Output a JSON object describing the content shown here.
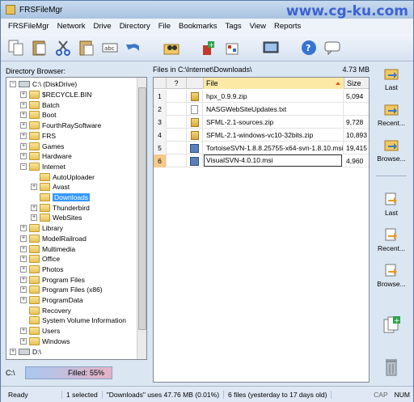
{
  "window": {
    "title": "FRSFileMgr",
    "watermark": "www.cg-ku.com"
  },
  "menu": [
    "FRSFileMgr",
    "Network",
    "Drive",
    "Directory",
    "File",
    "Bookmarks",
    "Tags",
    "View",
    "Reports"
  ],
  "left": {
    "label": "Directory Browser:",
    "tree": [
      {
        "label": "C:\\ (DiskDrive)",
        "level": 0,
        "type": "drive",
        "exp": "-"
      },
      {
        "label": "$RECYCLE.BIN",
        "level": 1,
        "exp": "+"
      },
      {
        "label": "Batch",
        "level": 1,
        "exp": "+"
      },
      {
        "label": "Boot",
        "level": 1,
        "exp": "+"
      },
      {
        "label": "FourthRaySoftware",
        "level": 1,
        "exp": "+"
      },
      {
        "label": "FRS",
        "level": 1,
        "exp": "+"
      },
      {
        "label": "Games",
        "level": 1,
        "exp": "+"
      },
      {
        "label": "Hardware",
        "level": 1,
        "exp": "+"
      },
      {
        "label": "Internet",
        "level": 1,
        "exp": "-"
      },
      {
        "label": "AutoUploader",
        "level": 2,
        "exp": ""
      },
      {
        "label": "Avast",
        "level": 2,
        "exp": "+"
      },
      {
        "label": "Downloads",
        "level": 2,
        "exp": "",
        "selected": true
      },
      {
        "label": "Thunderbird",
        "level": 2,
        "exp": "+"
      },
      {
        "label": "WebSites",
        "level": 2,
        "exp": "+"
      },
      {
        "label": "Library",
        "level": 1,
        "exp": "+"
      },
      {
        "label": "ModelRailroad",
        "level": 1,
        "exp": "+"
      },
      {
        "label": "Multimedia",
        "level": 1,
        "exp": "+"
      },
      {
        "label": "Office",
        "level": 1,
        "exp": "+"
      },
      {
        "label": "Photos",
        "level": 1,
        "exp": "+"
      },
      {
        "label": "Program Files",
        "level": 1,
        "exp": "+"
      },
      {
        "label": "Program Files (x86)",
        "level": 1,
        "exp": "+"
      },
      {
        "label": "ProgramData",
        "level": 1,
        "exp": "+"
      },
      {
        "label": "Recovery",
        "level": 1,
        "exp": ""
      },
      {
        "label": "System Volume Information",
        "level": 1,
        "exp": ""
      },
      {
        "label": "Users",
        "level": 1,
        "exp": "+"
      },
      {
        "label": "Windows",
        "level": 1,
        "exp": "+"
      },
      {
        "label": "D:\\",
        "level": 0,
        "type": "drive",
        "exp": "+"
      }
    ],
    "drive": "C:\\",
    "filled_label": "Filled:",
    "filled_pct": "55%"
  },
  "center": {
    "path_label": "Files in C:\\Internet\\Downloads\\",
    "size_total": "4.73 MB",
    "columns": {
      "q": "?",
      "file": "File",
      "size": "Size"
    },
    "files": [
      {
        "num": "1",
        "name": "hpx_0.9.9.zip",
        "size": "5,094",
        "kind": "zip"
      },
      {
        "num": "2",
        "name": "NASGWebSiteUpdates.txt",
        "size": "",
        "kind": "txt"
      },
      {
        "num": "3",
        "name": "SFML-2.1-sources.zip",
        "size": "9,728",
        "kind": "zip"
      },
      {
        "num": "4",
        "name": "SFML-2.1-windows-vc10-32bits.zip",
        "size": "10,893",
        "kind": "zip"
      },
      {
        "num": "5",
        "name": "TortoiseSVN-1.8.8.25755-x64-svn-1.8.10.msi",
        "size": "19,415",
        "kind": "msi"
      },
      {
        "num": "6",
        "name": "VisualSVN-4.0.10.msi",
        "size": "4,960",
        "kind": "msi",
        "editing": true
      }
    ]
  },
  "right": {
    "top": [
      "Last",
      "Recent...",
      "Browse..."
    ],
    "bottom": [
      "Last",
      "Recent...",
      "Browse..."
    ]
  },
  "status": {
    "ready": "Ready",
    "selected": "1 selected",
    "usage": "\"Downloads\" uses 47.76 MB (0.01%)",
    "files": "6 files (yesterday to 17 days old)",
    "keys": [
      "CAP",
      "NUM"
    ]
  },
  "colors": {
    "selection": "#3399ff",
    "accent": "#3d62d1"
  }
}
